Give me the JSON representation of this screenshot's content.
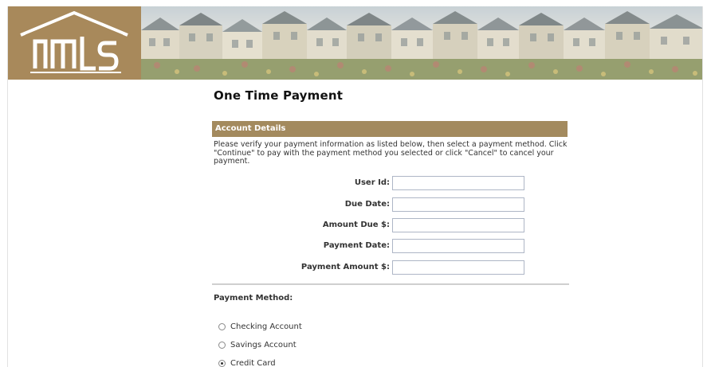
{
  "header": {
    "logo_text": "NMLS",
    "brand_color": "#a8895b"
  },
  "page": {
    "title": "One Time Payment"
  },
  "account_details": {
    "section_title": "Account Details",
    "instructions": "Please verify your payment information as listed below, then select a payment method. Click \"Continue\" to pay with the payment method you selected or click \"Cancel\" to cancel your payment.",
    "fields": [
      {
        "label": "User Id:",
        "value": ""
      },
      {
        "label": "Due Date:",
        "value": ""
      },
      {
        "label": "Amount Due $:",
        "value": ""
      },
      {
        "label": "Payment Date:",
        "value": ""
      },
      {
        "label": "Payment Amount $:",
        "value": ""
      }
    ]
  },
  "payment_method": {
    "title": "Payment Method:",
    "options": [
      {
        "label": "Checking Account",
        "selected": false
      },
      {
        "label": "Savings Account",
        "selected": false
      },
      {
        "label": "Credit Card",
        "selected": true
      }
    ]
  },
  "colors": {
    "section_bar": "#a38a5e",
    "input_border": "#aeb6c6"
  }
}
